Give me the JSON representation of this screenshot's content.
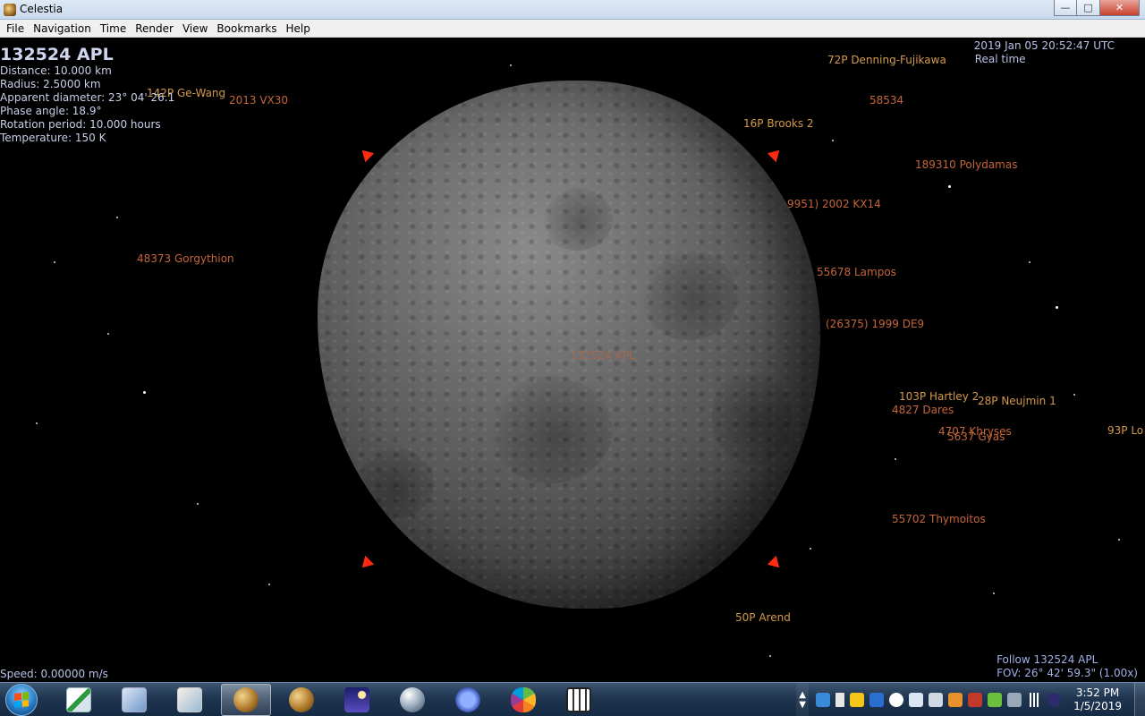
{
  "window": {
    "title": "Celestia",
    "minimize_label": "—",
    "maximize_label": "□",
    "close_label": "✕"
  },
  "menubar": {
    "items": [
      "File",
      "Navigation",
      "Time",
      "Render",
      "View",
      "Bookmarks",
      "Help"
    ]
  },
  "info": {
    "name": "132524 APL",
    "distance": "Distance: 10.000 km",
    "radius": "Radius: 2.5000 km",
    "apparent_diameter": "Apparent diameter: 23° 04' 26.1",
    "phase_angle": "Phase angle: 18.9°",
    "rotation_period": "Rotation period: 10.000 hours",
    "temperature": "Temperature: 150 K"
  },
  "time": {
    "datetime": "2019 Jan 05 20:52:47 UTC",
    "mode": "Real time"
  },
  "labels": {
    "ge_wang": "142P Ge-Wang",
    "vx30": "2013 VX30",
    "denning": "72P Denning-Fujikawa",
    "n58534": "58534",
    "brooks": "16P Brooks 2",
    "polydamas": "189310 Polydamas",
    "kx14": "9951) 2002 KX14",
    "gorgythion": "48373 Gorgythion",
    "lampos": "55678 Lampos",
    "overlap": "(26375) 1999 DE9",
    "center": "132524 APL",
    "hartley": "103P Hartley 2",
    "neujmin": "28P Neujmin 1",
    "dares": "4827 Dares",
    "khryses": "4707 Khryses",
    "gyas": "5637 Gyas",
    "lo": "93P Lo",
    "thymoitos": "55702 Thymoitos",
    "arend": "50P Arend"
  },
  "status": {
    "speed": "Speed: 0.00000 m/s",
    "follow": "Follow 132524 APL",
    "fov": "FOV: 26° 42' 59.3\" (1.00x)"
  },
  "taskbar": {
    "apps": [
      {
        "name": "documents-icon"
      },
      {
        "name": "control-panel-icon"
      },
      {
        "name": "notes-icon"
      },
      {
        "name": "celestia-icon",
        "active": true
      },
      {
        "name": "celestia-icon-2"
      },
      {
        "name": "night-sky-icon"
      },
      {
        "name": "sphere-icon"
      },
      {
        "name": "virus-icon"
      },
      {
        "name": "apple-icon"
      },
      {
        "name": "calculator-icon"
      }
    ],
    "clock_time": "3:52 PM",
    "clock_date": "1/5/2019"
  },
  "colors": {
    "label_orange": "#c5653a",
    "label_tan": "#d39a4a",
    "marker_red": "#ff2a12",
    "hud_text": "#c8d0e8"
  }
}
